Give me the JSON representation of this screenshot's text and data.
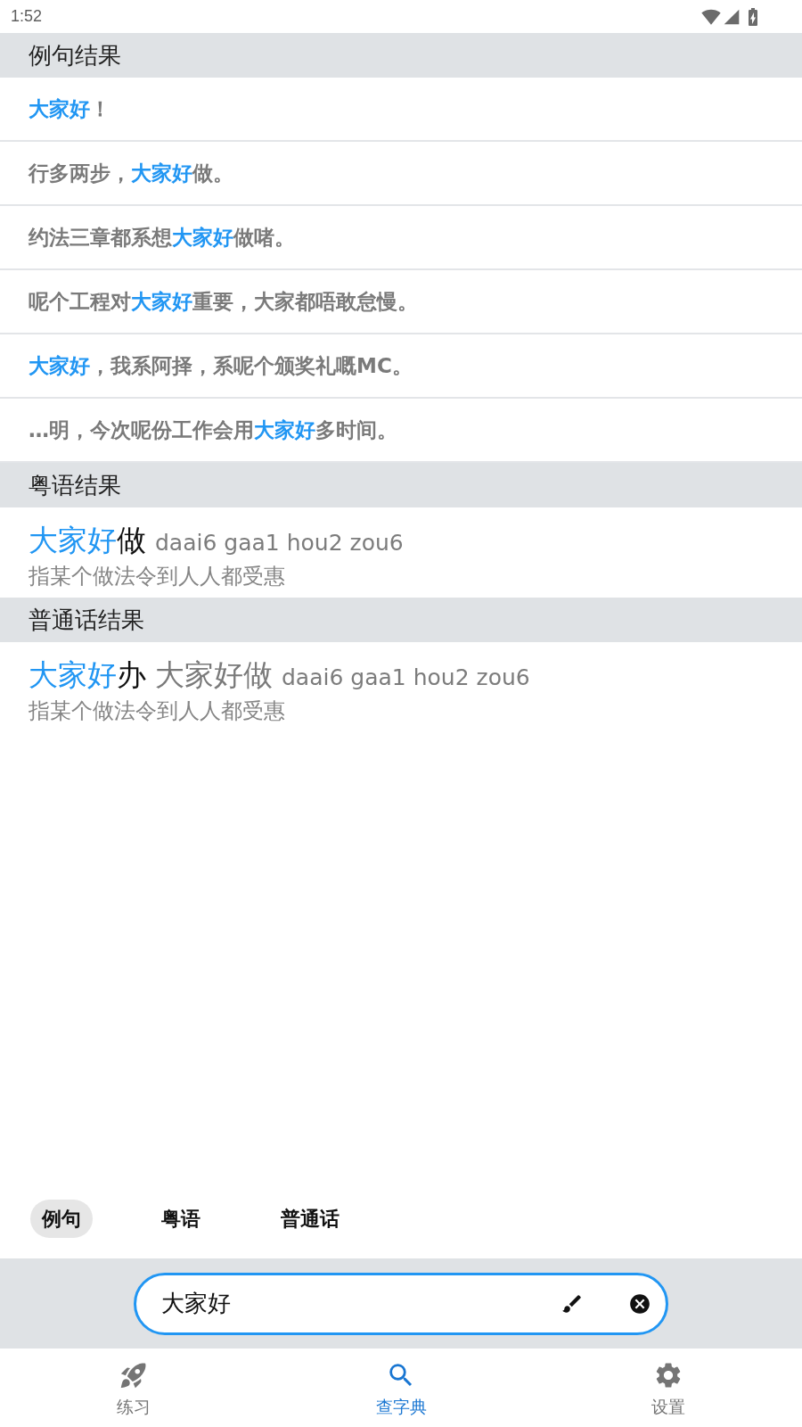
{
  "status_bar": {
    "time": "1:52"
  },
  "sections": [
    {
      "kind": "sentences",
      "title": "例句结果",
      "items": [
        {
          "parts": [
            {
              "text": "大家好",
              "highlight": true
            },
            {
              "text": "！",
              "highlight": false
            }
          ]
        },
        {
          "parts": [
            {
              "text": "行多两步，",
              "highlight": false
            },
            {
              "text": "大家好",
              "highlight": true
            },
            {
              "text": "做。",
              "highlight": false
            }
          ]
        },
        {
          "parts": [
            {
              "text": "约法三章都系想",
              "highlight": false
            },
            {
              "text": "大家好",
              "highlight": true
            },
            {
              "text": "做啫。",
              "highlight": false
            }
          ]
        },
        {
          "parts": [
            {
              "text": "呢个工程对",
              "highlight": false
            },
            {
              "text": "大家好",
              "highlight": true
            },
            {
              "text": "重要，大家都唔敢怠慢。",
              "highlight": false
            }
          ]
        },
        {
          "parts": [
            {
              "text": "大家好",
              "highlight": true
            },
            {
              "text": "，我系阿择，系呢个颁奖礼嘅MC。",
              "highlight": false
            }
          ]
        },
        {
          "parts": [
            {
              "text": "…明，今次呢份工作会用",
              "highlight": false
            },
            {
              "text": "大家好",
              "highlight": true
            },
            {
              "text": "多时间。",
              "highlight": false
            }
          ]
        }
      ]
    },
    {
      "kind": "entries",
      "title": "粤语结果",
      "items": [
        {
          "headword": [
            {
              "text": "大家好",
              "highlight": true
            },
            {
              "text": "做",
              "highlight": false
            }
          ],
          "jyutping": "daai6 gaa1 hou2 zou6",
          "definition": "指某个做法令到人人都受惠"
        }
      ]
    },
    {
      "kind": "entries",
      "title": "普通话结果",
      "items": [
        {
          "headword": [
            {
              "text": "大家好",
              "highlight": true
            },
            {
              "text": "办",
              "highlight": false
            }
          ],
          "variant": "大家好做",
          "jyutping": "daai6 gaa1 hou2 zou6",
          "definition": "指某个做法令到人人都受惠"
        }
      ]
    }
  ],
  "filter_chips": [
    {
      "label": "例句",
      "selected": true
    },
    {
      "label": "粤语",
      "selected": false
    },
    {
      "label": "普通话",
      "selected": false
    }
  ],
  "search": {
    "value": "大家好"
  },
  "bottom_nav": [
    {
      "label": "练习",
      "selected": false
    },
    {
      "label": "查字典",
      "selected": true
    },
    {
      "label": "设置",
      "selected": false
    }
  ]
}
